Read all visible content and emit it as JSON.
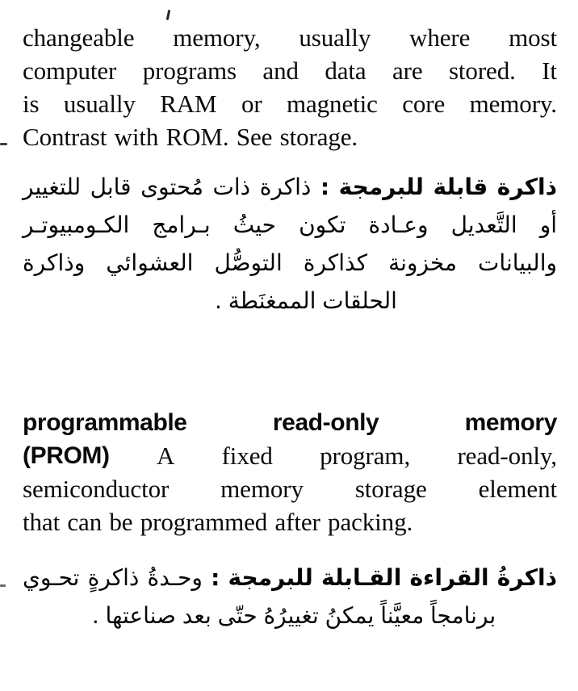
{
  "page": {
    "background_color": "#ffffff",
    "ink_color": "#000000",
    "kind": "scanned-bilingual-dictionary-page"
  },
  "entries": [
    {
      "id": "programmable-memory",
      "english": {
        "lines": [
          [
            "changeable",
            "memory,",
            "usually",
            "where",
            "most"
          ],
          [
            "computer",
            "programs",
            "and",
            "data",
            "are",
            "stored.",
            "It"
          ],
          [
            "is",
            "usually",
            "RAM",
            "or",
            "magnetic",
            "core",
            "memory."
          ],
          [
            "Contrast",
            "with",
            "ROM.",
            "See",
            "storage."
          ]
        ],
        "full_text": "changeable memory, usually where most computer programs and data are stored. It is usually RAM or magnetic core memory. Contrast with ROM. See storage."
      },
      "arabic": {
        "headword": "ذاكرة قابلة للبرمجة",
        "separator": ":",
        "lines": [
          [
            "ذاكرة",
            "قابلة",
            "للبرمجة",
            ":",
            "ذاكرة",
            "ذات",
            "مُحتوى",
            "قابل",
            "للتغيير"
          ],
          [
            "أو",
            "التَّعديل",
            "وعـادة",
            "تكون",
            "حيثُ",
            "بـرامج",
            "الكـومبيوتـر"
          ],
          [
            "والبيانات",
            "مخزونة",
            "كذاكرة",
            "التوصُّل",
            "العشوائي",
            "وذاكرة"
          ],
          [
            "الحلقات",
            "الممغنَطة",
            "."
          ]
        ],
        "full_text": "ذاكرة قابلة للبرمجة : ذاكرة ذات مُحتوى قابل للتغيير أو التَّعديل وعـادة تكون حيثُ بـرامج الكـومبيوتـر والبيانات مخزونة كذاكرة التوصُّل العشوائي وذاكرة الحلقات الممغنَطة ."
      }
    },
    {
      "id": "prom",
      "english": {
        "headword": "programmable read-only memory (PROM)",
        "lines": [
          [
            {
              "text": "programmable",
              "bold": true
            },
            {
              "text": "read-only",
              "bold": true
            },
            {
              "text": "memory",
              "bold": true
            }
          ],
          [
            {
              "text": "(PROM)",
              "bold": true
            },
            {
              "text": "A",
              "bold": false
            },
            {
              "text": "fixed",
              "bold": false
            },
            {
              "text": "program,",
              "bold": false
            },
            {
              "text": "read-only,",
              "bold": false
            }
          ],
          [
            {
              "text": "semiconductor",
              "bold": false
            },
            {
              "text": "memory",
              "bold": false
            },
            {
              "text": "storage",
              "bold": false
            },
            {
              "text": "element",
              "bold": false
            }
          ],
          [
            {
              "text": "that",
              "bold": false
            },
            {
              "text": "can",
              "bold": false
            },
            {
              "text": "be",
              "bold": false
            },
            {
              "text": "programmed",
              "bold": false
            },
            {
              "text": "after",
              "bold": false
            },
            {
              "text": "packing.",
              "bold": false
            }
          ]
        ],
        "full_text": "programmable read-only memory (PROM) A fixed program, read-only, semiconductor memory storage element that can be programmed after packing."
      },
      "arabic": {
        "headword": "ذاكرةُ القراءة القابلة للبرمجة",
        "separator": ":",
        "lines": [
          [
            "ذاكرةُ",
            "القراءة",
            "القـابلة",
            "للبرمجة",
            ":",
            "وحـدةُ",
            "ذاكرةٍ",
            "تحـوي"
          ],
          [
            "برنامجاً",
            "معيَّناً",
            "يمكنُ",
            "تغييرُهُ",
            "حتّى",
            "بعد",
            "صناعتها",
            "."
          ]
        ],
        "full_text": "ذاكرةُ القراءة القـابلة للبرمجة : وحـدةُ ذاكرةٍ تحـوي برنامجاً معيَّناً يمكنُ تغييرُهُ حتّى بعد صناعتها ."
      }
    }
  ],
  "artifacts": [
    {
      "name": "apostrophe-speck",
      "description": "ink speck above the word changeable"
    },
    {
      "name": "left-edge-dash",
      "description": "scan dash at left margin"
    },
    {
      "name": "left-edge-dash-lower",
      "description": "faint scan dash at lower left margin"
    }
  ]
}
